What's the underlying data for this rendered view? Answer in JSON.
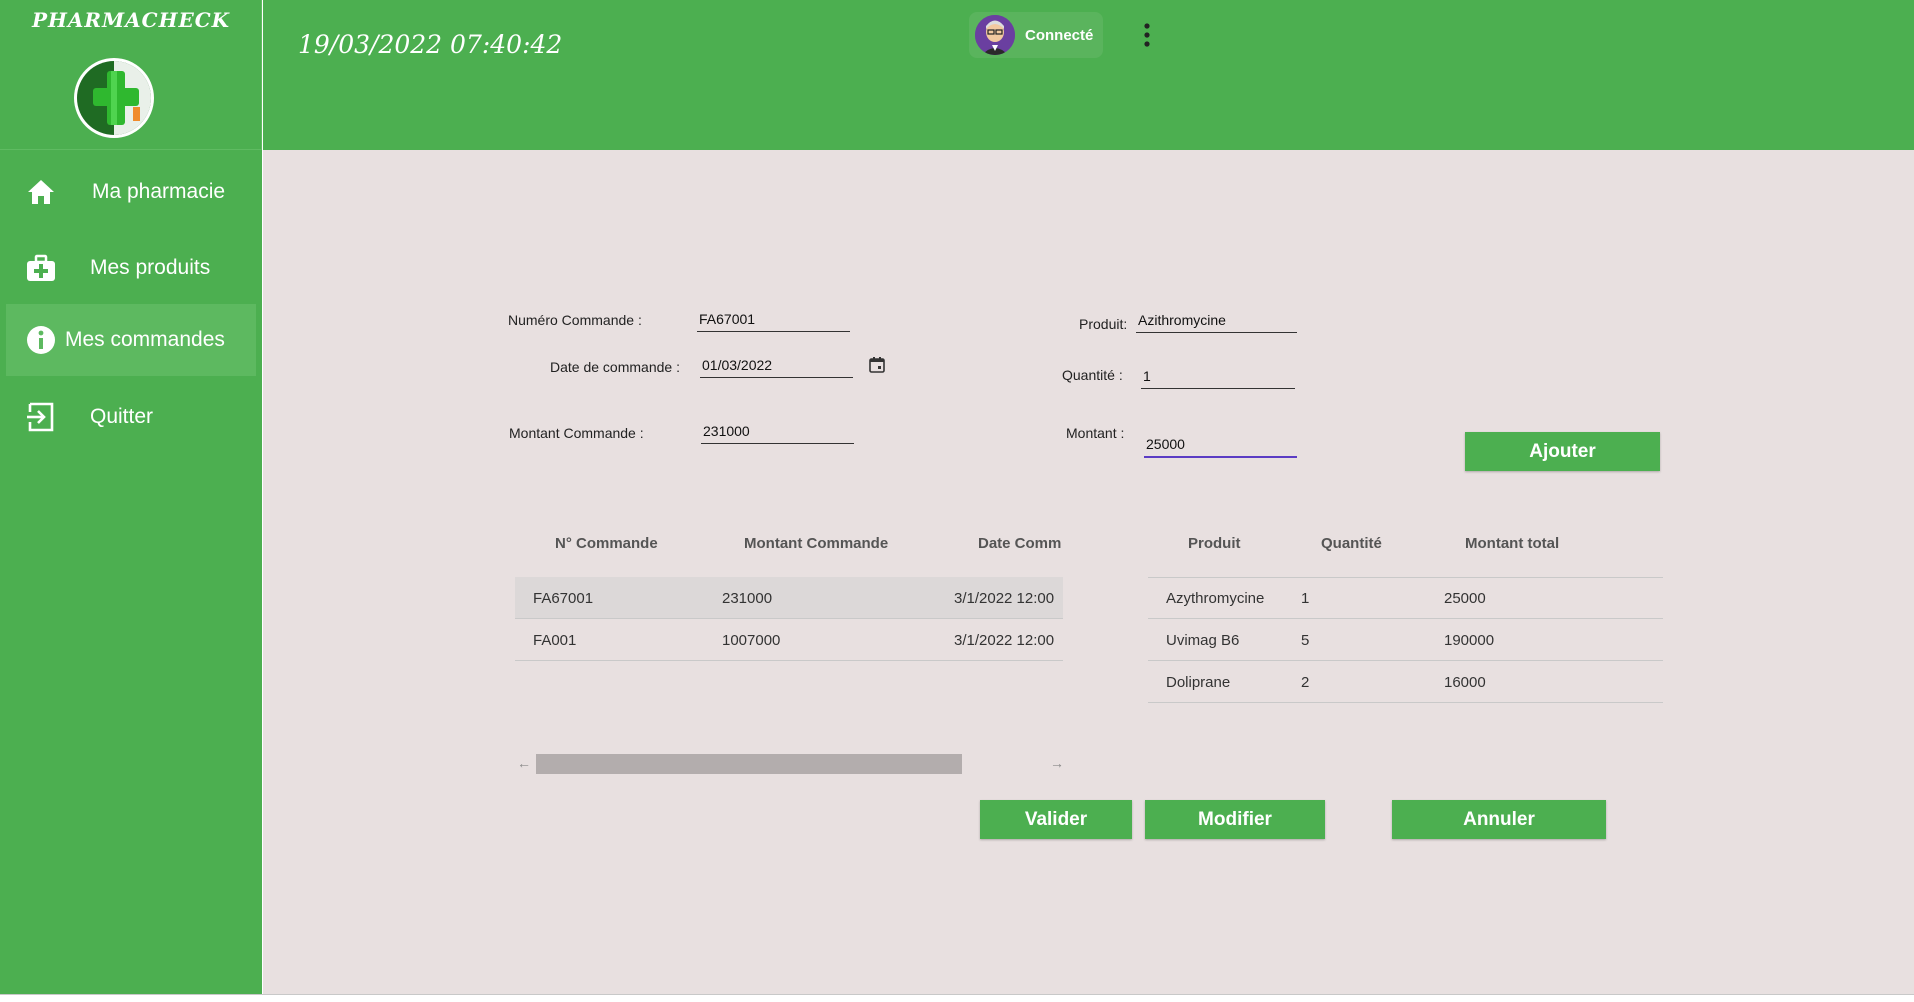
{
  "app": {
    "brand": "PHARMACHECK",
    "datetime": "19/03/2022 07:40:42"
  },
  "user": {
    "status": "Connecté"
  },
  "sidebar": {
    "items": [
      {
        "label": "Ma pharmacie",
        "icon": "home-icon"
      },
      {
        "label": "Mes produits",
        "icon": "medkit-icon"
      },
      {
        "label": "Mes commandes",
        "icon": "info-icon",
        "active": true
      },
      {
        "label": "Quitter",
        "icon": "exit-icon"
      }
    ]
  },
  "form": {
    "numero_label": "Numéro Commande :",
    "numero_value": "FA67001",
    "date_label": "Date de commande :",
    "date_value": "01/03/2022",
    "montant_cmd_label": "Montant Commande :",
    "montant_cmd_value": "231000",
    "produit_label": "Produit:",
    "produit_value": "Azithromycine",
    "quantite_label": "Quantité :",
    "quantite_value": "1",
    "montant_label": "Montant :",
    "montant_value": "25000"
  },
  "buttons": {
    "ajouter": "Ajouter",
    "valider": "Valider",
    "modifier": "Modifier",
    "annuler": "Annuler"
  },
  "orders_table": {
    "headers": [
      "N° Commande",
      "Montant Commande",
      "Date Comm"
    ],
    "rows": [
      {
        "num": "FA67001",
        "montant": "231000",
        "date": "3/1/2022 12:00",
        "selected": true
      },
      {
        "num": "FA001",
        "montant": "1007000",
        "date": "3/1/2022 12:00"
      }
    ]
  },
  "products_table": {
    "headers": [
      "Produit",
      "Quantité",
      "Montant total"
    ],
    "rows": [
      {
        "produit": "Azythromycine",
        "quantite": "1",
        "montant": "25000"
      },
      {
        "produit": "Uvimag B6",
        "quantite": "5",
        "montant": "190000"
      },
      {
        "produit": "Doliprane",
        "quantite": "2",
        "montant": "16000"
      }
    ]
  },
  "colors": {
    "primary": "#4caf50",
    "background": "#e8e0e0",
    "focus": "#5b3cc4"
  }
}
